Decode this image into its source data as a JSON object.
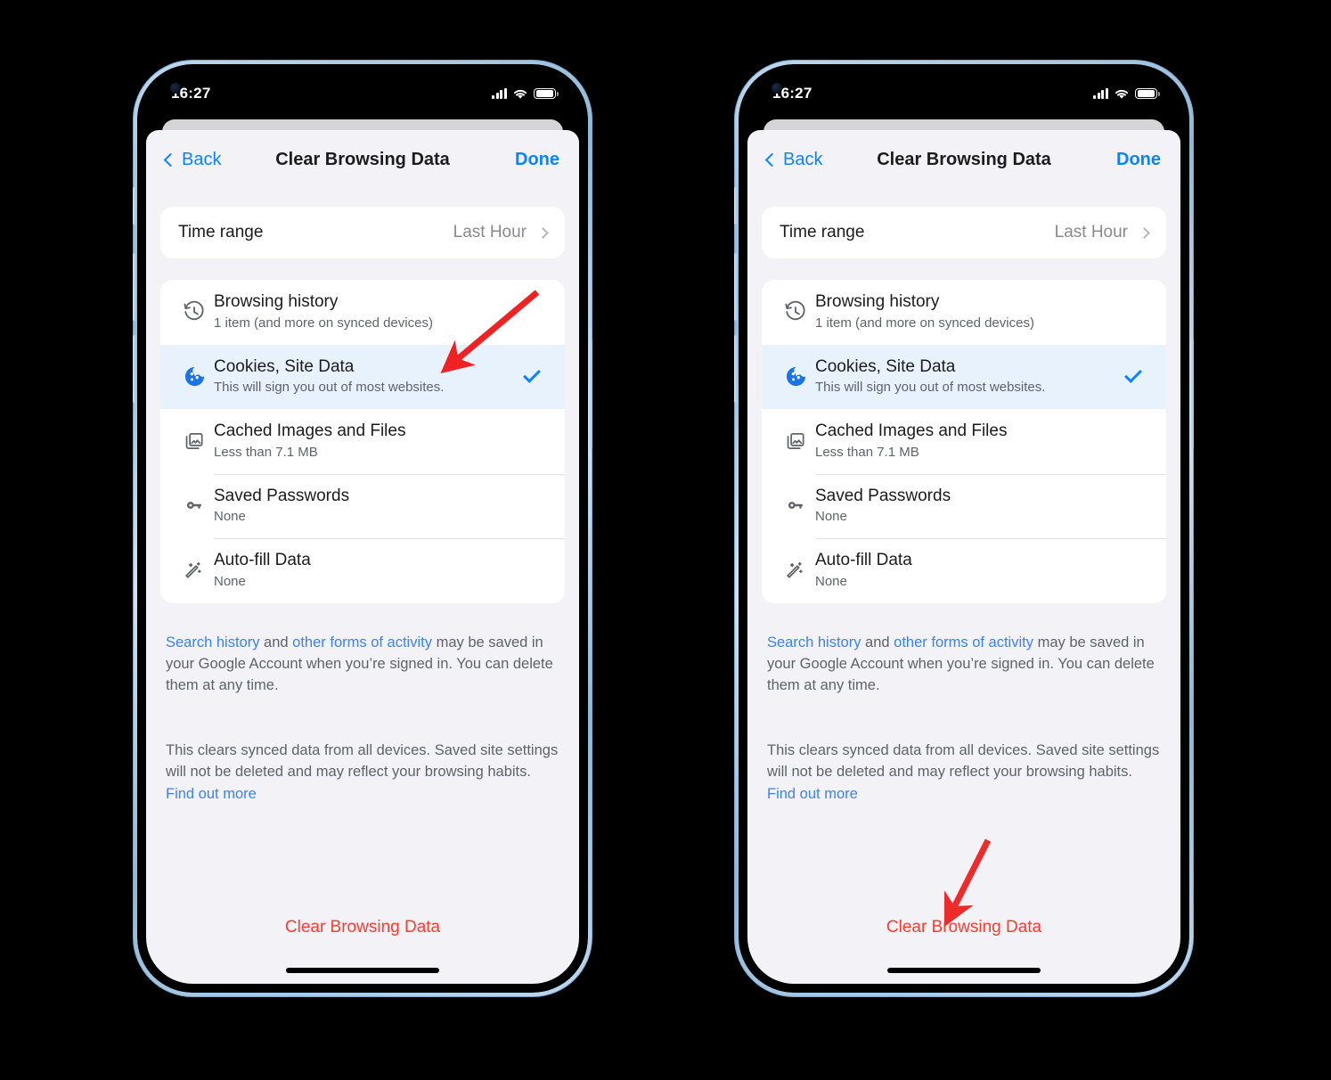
{
  "accent": "#0a84ff",
  "danger": "#ff3b30",
  "link": "#3b82f6",
  "statusbar": {
    "time": "16:27",
    "signal_icon": "cellular-bars-icon",
    "wifi_icon": "wifi-icon",
    "battery_icon": "battery-icon"
  },
  "nav": {
    "back_label": "Back",
    "title": "Clear Browsing Data",
    "done_label": "Done"
  },
  "time_range": {
    "label": "Time range",
    "value": "Last Hour"
  },
  "options": [
    {
      "icon": "history-clock-icon",
      "title": "Browsing history",
      "subtitle": "1 item (and more on synced devices)",
      "selected": false
    },
    {
      "icon": "cookie-icon",
      "title": "Cookies, Site Data",
      "subtitle": "This will sign you out of most websites.",
      "selected": true
    },
    {
      "icon": "photo-stack-icon",
      "title": "Cached Images and Files",
      "subtitle": "Less than 7.1 MB",
      "selected": false
    },
    {
      "icon": "key-icon",
      "title": "Saved Passwords",
      "subtitle": "None",
      "selected": false
    },
    {
      "icon": "magic-wand-icon",
      "title": "Auto-fill Data",
      "subtitle": "None",
      "selected": false
    }
  ],
  "footnote_one": {
    "link1": "Search history",
    "mid": " and ",
    "link2": "other forms of activity",
    "rest": " may be saved in your Google Account when you’re signed in. You can delete them at any time."
  },
  "footnote_two": {
    "text": "This clears synced data from all devices. Saved site settings will not be deleted and may reflect your browsing habits. ",
    "link": "Find out more"
  },
  "clear_button_label": "Clear Browsing Data",
  "annotations": [
    {
      "name": "arrow-to-cookies-row",
      "color": "#ee2222"
    },
    {
      "name": "arrow-to-clear-button",
      "color": "#ee2b2b"
    }
  ]
}
